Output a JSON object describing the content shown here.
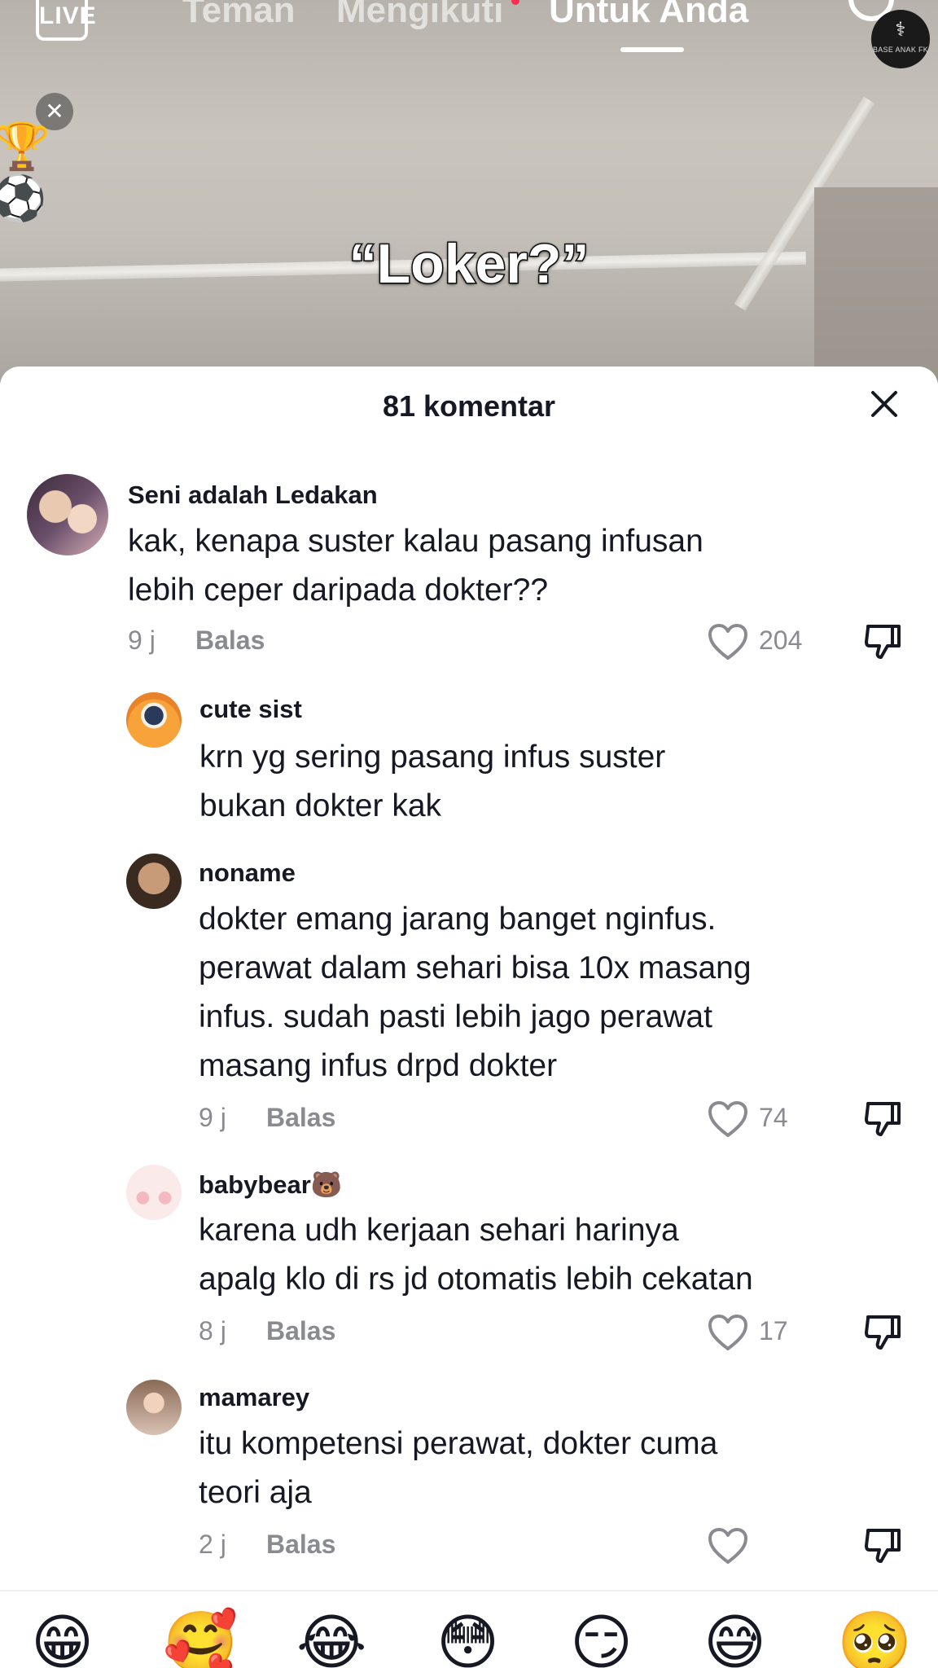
{
  "nav": {
    "live_label": "LIVE",
    "tabs": [
      {
        "label": "Teman",
        "active": false
      },
      {
        "label": "Mengikuti",
        "active": false,
        "has_dot": true
      },
      {
        "label": "Untuk Anda",
        "active": true
      }
    ],
    "watermark_text": "BASE ANAK FK"
  },
  "video": {
    "caption": "“Loker?”",
    "side_icons": [
      "trophy-emoji",
      "soccer-ball-emoji"
    ],
    "trophy_glyph": "🏆",
    "ball_glyph": "⚽",
    "close_glyph": "✕"
  },
  "comments_panel": {
    "title": "81 komentar",
    "comments": [
      {
        "username": "Seni adalah Ledakan",
        "lines": [
          "kak, kenapa suster kalau pasang infusan",
          "lebih ceper daripada dokter??"
        ],
        "time": "9 j",
        "reply_label": "Balas",
        "likes": "204"
      },
      {
        "username": "cute sist",
        "lines": [
          "krn yg sering pasang infus suster",
          "bukan dokter kak"
        ]
      },
      {
        "username": "noname",
        "lines": [
          "dokter emang jarang banget nginfus.",
          "perawat dalam sehari bisa 10x masang",
          "infus. sudah pasti lebih jago perawat",
          "masang infus drpd dokter"
        ],
        "time": "9 j",
        "reply_label": "Balas",
        "likes": "74"
      },
      {
        "username": "babybear🐻",
        "lines": [
          "karena udh kerjaan sehari harinya",
          "apalg klo di rs jd otomatis lebih cekatan"
        ],
        "time": "8 j",
        "reply_label": "Balas",
        "likes": "17"
      },
      {
        "username": "mamarey",
        "lines": [
          "itu kompetensi perawat, dokter cuma",
          "teori aja"
        ],
        "time": "2 j",
        "reply_label": "Balas",
        "likes": ""
      }
    ]
  },
  "emoji_bar": [
    "😁",
    "🥰",
    "😂",
    "😳",
    "😏",
    "😅",
    "🥺"
  ],
  "colors": {
    "accent_dot": "#fe2c55",
    "text_primary": "#161823",
    "text_secondary": "#8a8b91"
  }
}
